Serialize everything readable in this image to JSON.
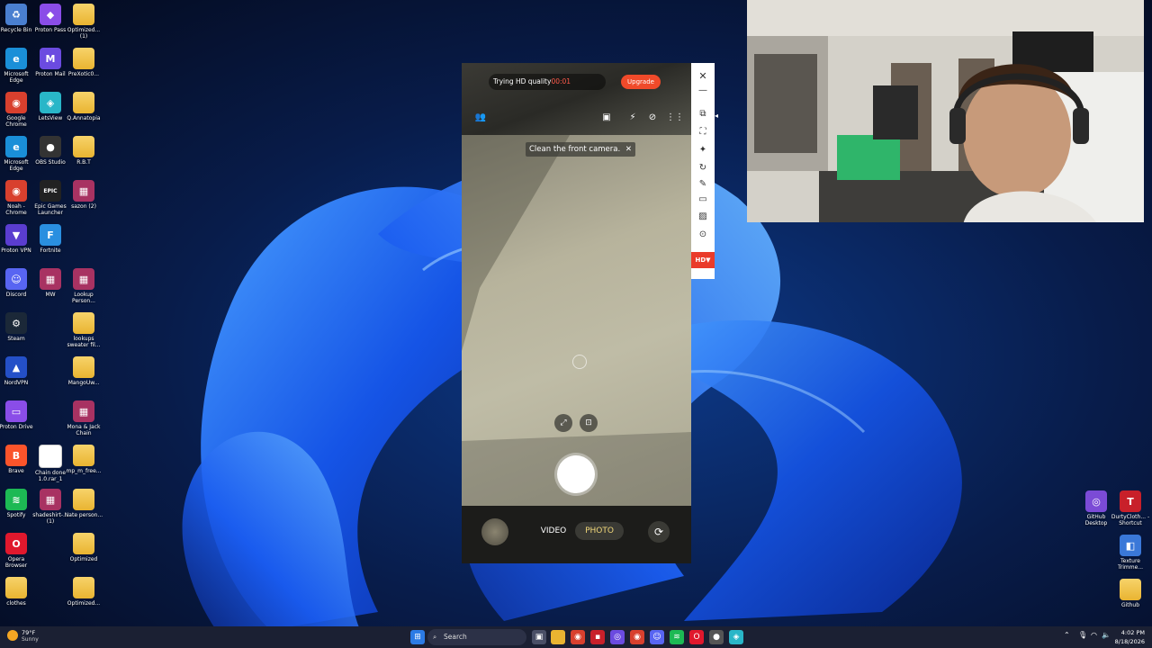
{
  "desktop": {
    "icons": [
      {
        "label": "Recycle Bin",
        "icon": "recycle-bin-icon",
        "color": "#4a7fd0",
        "glyph": "♻"
      },
      {
        "label": "Proton Pass",
        "icon": "proton-pass-icon",
        "color": "#8a4de8",
        "glyph": "◆"
      },
      {
        "label": "Optimized... (1)",
        "icon": "folder-icon",
        "color": "#e9b431",
        "glyph": ""
      },
      {
        "label": "Microsoft Edge",
        "icon": "edge-icon",
        "color": "#1a8fd8",
        "glyph": "e"
      },
      {
        "label": "Proton Mail",
        "icon": "proton-mail-icon",
        "color": "#6b4be0",
        "glyph": "M"
      },
      {
        "label": "PreXotic0...",
        "icon": "folder-icon",
        "color": "#e9b431",
        "glyph": ""
      },
      {
        "label": "Google Chrome",
        "icon": "chrome-icon",
        "color": "#d8402e",
        "glyph": "◉"
      },
      {
        "label": "LetsView",
        "icon": "letsview-icon",
        "color": "#29b6c8",
        "glyph": "◈"
      },
      {
        "label": "Q.Annatopia",
        "icon": "folder-icon",
        "color": "#e9b431",
        "glyph": ""
      },
      {
        "label": "Microsoft Edge",
        "icon": "edge-icon",
        "color": "#1a8fd8",
        "glyph": "e"
      },
      {
        "label": "OBS Studio",
        "icon": "obs-icon",
        "color": "#333333",
        "glyph": "●"
      },
      {
        "label": "R.B.T",
        "icon": "folder-icon",
        "color": "#e9b431",
        "glyph": ""
      },
      {
        "label": "Noah - Chrome",
        "icon": "chrome-icon",
        "color": "#d8402e",
        "glyph": "◉"
      },
      {
        "label": "Epic Games Launcher",
        "icon": "epic-games-icon",
        "color": "#222222",
        "glyph": "EPIC"
      },
      {
        "label": "sazon (2)",
        "icon": "winrar-icon",
        "color": "#a83262",
        "glyph": "▦"
      },
      {
        "label": "Proton VPN",
        "icon": "proton-vpn-icon",
        "color": "#5a3dd0",
        "glyph": "▼"
      },
      {
        "label": "Fortnite",
        "icon": "fortnite-icon",
        "color": "#2a8fe0",
        "glyph": "F"
      },
      {
        "label": "Discord",
        "icon": "discord-icon",
        "color": "#5865f2",
        "glyph": "☺"
      },
      {
        "label": "MW",
        "icon": "winrar-icon",
        "color": "#a83262",
        "glyph": "▦"
      },
      {
        "label": "Lookup Person...",
        "icon": "winrar-icon",
        "color": "#a83262",
        "glyph": "▦"
      },
      {
        "label": "Steam",
        "icon": "steam-icon",
        "color": "#1b2838",
        "glyph": "⚙"
      },
      {
        "label": "lookups sweater fil...",
        "icon": "folder-icon",
        "color": "#e9b431",
        "glyph": ""
      },
      {
        "label": "NordVPN",
        "icon": "nordvpn-icon",
        "color": "#2450c8",
        "glyph": "▲"
      },
      {
        "label": "MangoUw...",
        "icon": "folder-icon",
        "color": "#e9b431",
        "glyph": ""
      },
      {
        "label": "Proton Drive",
        "icon": "proton-drive-icon",
        "color": "#8a4de8",
        "glyph": "▭"
      },
      {
        "label": "Mona & Jack Chain",
        "icon": "winrar-icon",
        "color": "#a83262",
        "glyph": "▦"
      },
      {
        "label": "Brave",
        "icon": "brave-icon",
        "color": "#fb542b",
        "glyph": "B"
      },
      {
        "label": "Chain done 1.0.rar_1",
        "icon": "file-icon",
        "color": "#ffffff",
        "glyph": ""
      },
      {
        "label": "mp_m_free...",
        "icon": "folder-icon",
        "color": "#e9b431",
        "glyph": ""
      },
      {
        "label": "Spotify",
        "icon": "spotify-icon",
        "color": "#1db954",
        "glyph": "≋"
      },
      {
        "label": "shadeshirt-... (1)",
        "icon": "winrar-icon",
        "color": "#a83262",
        "glyph": "▦"
      },
      {
        "label": "Nate person...",
        "icon": "folder-icon",
        "color": "#e9b431",
        "glyph": ""
      },
      {
        "label": "Opera Browser",
        "icon": "opera-icon",
        "color": "#e0182d",
        "glyph": "O"
      },
      {
        "label": "Optimized",
        "icon": "folder-icon",
        "color": "#e9b431",
        "glyph": ""
      },
      {
        "label": "clothes",
        "icon": "folder-icon",
        "color": "#e9b431",
        "glyph": ""
      },
      {
        "label": "Optimized...",
        "icon": "folder-icon",
        "color": "#e9b431",
        "glyph": ""
      }
    ],
    "right_icons": [
      {
        "label": "GitHub Desktop",
        "icon": "github-desktop-icon",
        "color": "#7b4bd6",
        "glyph": "◎"
      },
      {
        "label": "DurtyCloth... - Shortcut",
        "icon": "tshirt-icon",
        "color": "#c8202a",
        "glyph": "T"
      },
      {
        "label": "Texture Trimme...",
        "icon": "texture-trimmer-icon",
        "color": "#3a78d8",
        "glyph": "◧"
      },
      {
        "label": "Github",
        "icon": "folder-icon",
        "color": "#e9b431",
        "glyph": ""
      }
    ]
  },
  "phone": {
    "hd_trial_text": "Trying HD quality",
    "hd_timer": "00:01",
    "upgrade_label": "Upgrade",
    "close_glyph": "✕",
    "minimize_glyph": "—",
    "tip_text": "Clean the front camera.",
    "tip_close": "✕",
    "mode_video": "VIDEO",
    "mode_photo": "PHOTO",
    "hd_badge": "HD▼"
  },
  "taskbar": {
    "weather_temp": "79°F",
    "weather_desc": "Sunny",
    "search_placeholder": "Search",
    "clock_time": "4:02 PM",
    "clock_date": "8/18/2026"
  }
}
